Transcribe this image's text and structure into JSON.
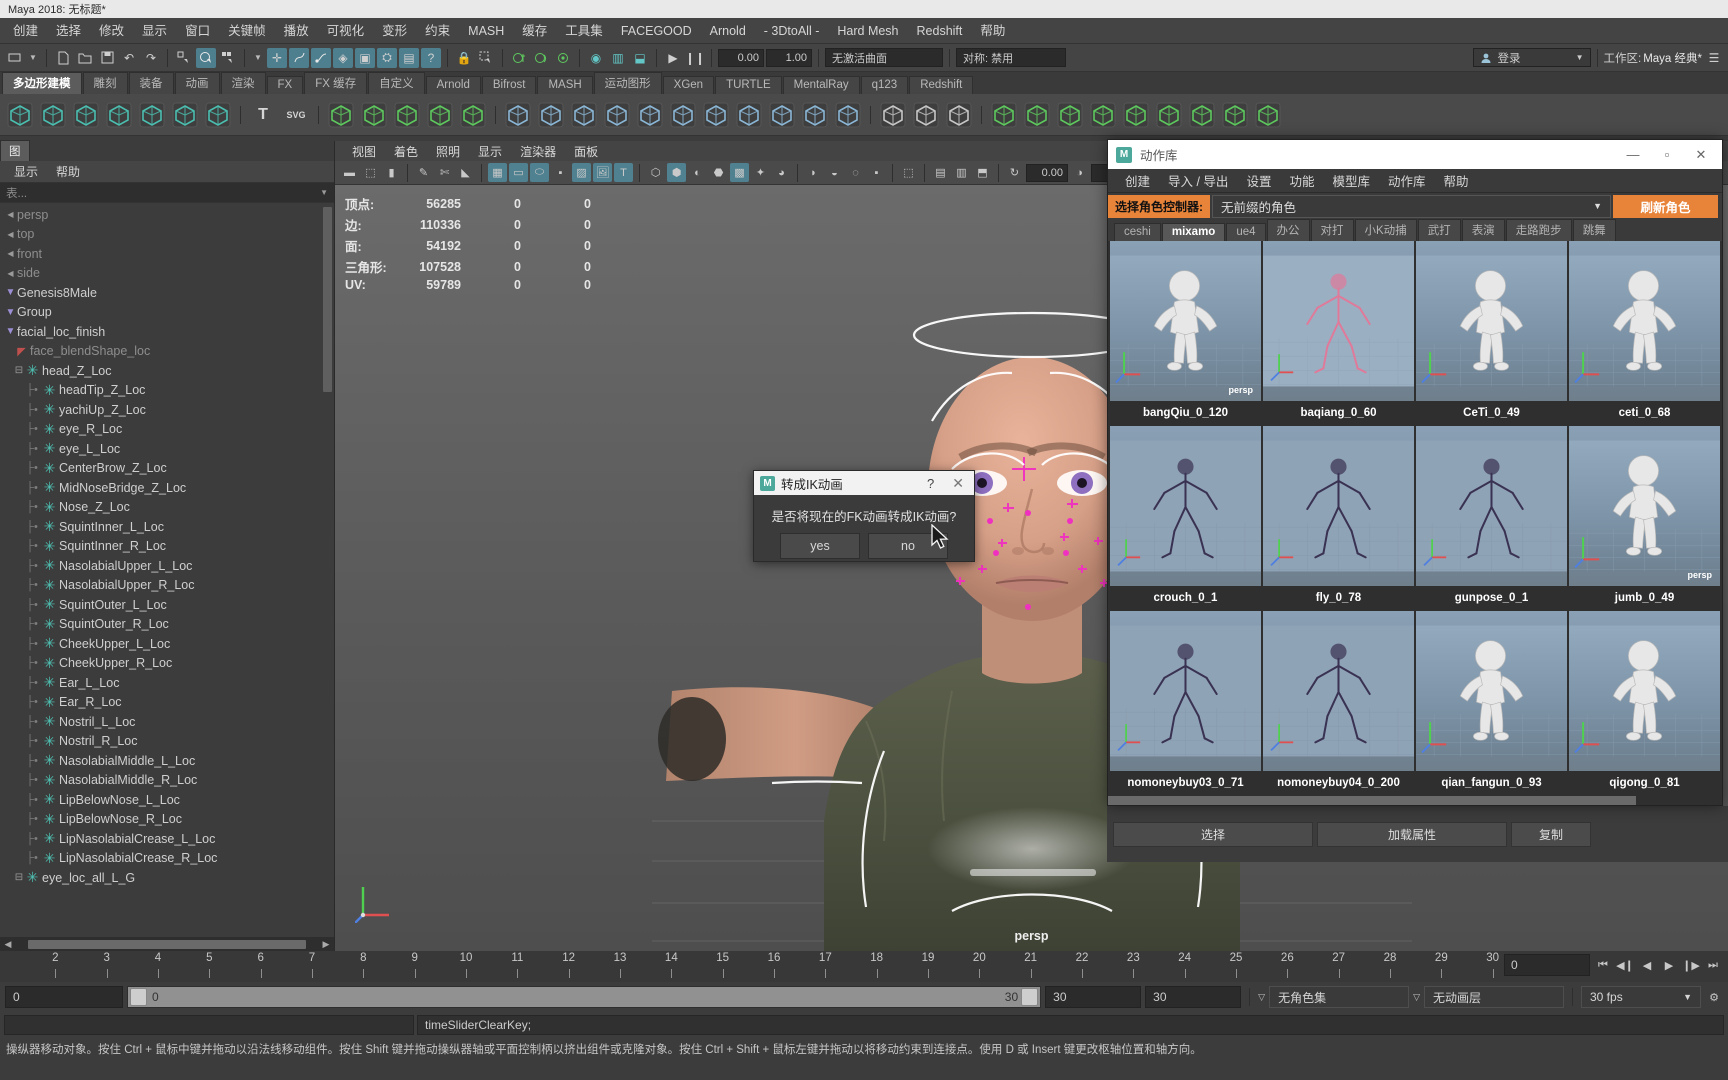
{
  "window": {
    "title": "Maya 2018: 无标题*"
  },
  "menubar": {
    "items": [
      "创建",
      "选择",
      "修改",
      "显示",
      "窗口",
      "关键帧",
      "播放",
      "可视化",
      "变形",
      "约束",
      "MASH",
      "缓存",
      "工具集",
      "FACEGOOD",
      "Arnold",
      "- 3DtoAll -",
      "Hard Mesh",
      "Redshift",
      "帮助"
    ]
  },
  "status_bar": {
    "symmetry_label": "对称: 禁用",
    "active_curve_field": "无激活曲面",
    "num_a": "0.00",
    "num_b": "1.00",
    "login_label": "登录",
    "workspace_label": "工作区:",
    "workspace_value": "Maya 经典*"
  },
  "shelf": {
    "tabs": [
      "多边形建模",
      "雕刻",
      "装备",
      "动画",
      "渲染",
      "FX",
      "FX 缓存",
      "自定义",
      "Arnold",
      "Bifrost",
      "MASH",
      "运动图形",
      "XGen",
      "TURTLE",
      "MentalRay",
      "q123",
      "Redshift"
    ],
    "active_tab": "多边形建模"
  },
  "outliner": {
    "tab_label": "图",
    "menu": [
      "显示",
      "帮助"
    ],
    "search_placeholder": "表...",
    "items": [
      {
        "label": "persp",
        "type": "camera",
        "dim": true,
        "indent": 0
      },
      {
        "label": "top",
        "type": "camera",
        "dim": true,
        "indent": 0
      },
      {
        "label": "front",
        "type": "camera",
        "dim": true,
        "indent": 0
      },
      {
        "label": "side",
        "type": "camera",
        "dim": true,
        "indent": 0
      },
      {
        "label": "Genesis8Male",
        "type": "group",
        "dim": false,
        "indent": 0
      },
      {
        "label": "Group",
        "type": "group",
        "dim": false,
        "indent": 0
      },
      {
        "label": "facial_loc_finish",
        "type": "group",
        "dim": false,
        "indent": 0
      },
      {
        "label": "face_blendShape_loc",
        "type": "blendshape",
        "dim": true,
        "indent": 1
      },
      {
        "label": "head_Z_Loc",
        "type": "locator-root",
        "dim": false,
        "indent": 1
      },
      {
        "label": "headTip_Z_Loc",
        "type": "locator",
        "dim": false,
        "indent": 2
      },
      {
        "label": "yachiUp_Z_Loc",
        "type": "locator",
        "dim": false,
        "indent": 2
      },
      {
        "label": "eye_R_Loc",
        "type": "locator",
        "dim": false,
        "indent": 2
      },
      {
        "label": "eye_L_Loc",
        "type": "locator",
        "dim": false,
        "indent": 2
      },
      {
        "label": "CenterBrow_Z_Loc",
        "type": "locator",
        "dim": false,
        "indent": 2
      },
      {
        "label": "MidNoseBridge_Z_Loc",
        "type": "locator",
        "dim": false,
        "indent": 2
      },
      {
        "label": "Nose_Z_Loc",
        "type": "locator",
        "dim": false,
        "indent": 2
      },
      {
        "label": "SquintInner_L_Loc",
        "type": "locator",
        "dim": false,
        "indent": 2
      },
      {
        "label": "SquintInner_R_Loc",
        "type": "locator",
        "dim": false,
        "indent": 2
      },
      {
        "label": "NasolabialUpper_L_Loc",
        "type": "locator",
        "dim": false,
        "indent": 2
      },
      {
        "label": "NasolabialUpper_R_Loc",
        "type": "locator",
        "dim": false,
        "indent": 2
      },
      {
        "label": "SquintOuter_L_Loc",
        "type": "locator",
        "dim": false,
        "indent": 2
      },
      {
        "label": "SquintOuter_R_Loc",
        "type": "locator",
        "dim": false,
        "indent": 2
      },
      {
        "label": "CheekUpper_L_Loc",
        "type": "locator",
        "dim": false,
        "indent": 2
      },
      {
        "label": "CheekUpper_R_Loc",
        "type": "locator",
        "dim": false,
        "indent": 2
      },
      {
        "label": "Ear_L_Loc",
        "type": "locator",
        "dim": false,
        "indent": 2
      },
      {
        "label": "Ear_R_Loc",
        "type": "locator",
        "dim": false,
        "indent": 2
      },
      {
        "label": "Nostril_L_Loc",
        "type": "locator",
        "dim": false,
        "indent": 2
      },
      {
        "label": "Nostril_R_Loc",
        "type": "locator",
        "dim": false,
        "indent": 2
      },
      {
        "label": "NasolabialMiddle_L_Loc",
        "type": "locator",
        "dim": false,
        "indent": 2
      },
      {
        "label": "NasolabialMiddle_R_Loc",
        "type": "locator",
        "dim": false,
        "indent": 2
      },
      {
        "label": "LipBelowNose_L_Loc",
        "type": "locator",
        "dim": false,
        "indent": 2
      },
      {
        "label": "LipBelowNose_R_Loc",
        "type": "locator",
        "dim": false,
        "indent": 2
      },
      {
        "label": "LipNasolabialCrease_L_Loc",
        "type": "locator",
        "dim": false,
        "indent": 2
      },
      {
        "label": "LipNasolabialCrease_R_Loc",
        "type": "locator",
        "dim": false,
        "indent": 2
      },
      {
        "label": "eye_loc_all_L_G",
        "type": "locator-root",
        "dim": false,
        "indent": 1
      }
    ]
  },
  "viewport": {
    "menu": [
      "视图",
      "着色",
      "照明",
      "显示",
      "渲染器",
      "面板"
    ],
    "hud": [
      {
        "label": "顶点:",
        "v1": "56285",
        "v2": "0",
        "v3": "0"
      },
      {
        "label": "边:",
        "v1": "110336",
        "v2": "0",
        "v3": "0"
      },
      {
        "label": "面:",
        "v1": "54192",
        "v2": "0",
        "v3": "0"
      },
      {
        "label": "三角形:",
        "v1": "107528",
        "v2": "0",
        "v3": "0"
      },
      {
        "label": "UV:",
        "v1": "59789",
        "v2": "0",
        "v3": "0"
      }
    ],
    "camera_label": "persp"
  },
  "dialog": {
    "title": "转成IK动画",
    "help_glyph": "?",
    "close_glyph": "✕",
    "message": "是否将现在的FK动画转成IK动画?",
    "yes_label": "yes",
    "no_label": "no"
  },
  "motion_library": {
    "title": "动作库",
    "minimize_glyph": "—",
    "maximize_glyph": "▫",
    "close_glyph": "✕",
    "menu": [
      "创建",
      "导入 / 导出",
      "设置",
      "功能",
      "模型库",
      "动作库",
      "帮助"
    ],
    "selector_label": "选择角色控制器:",
    "selector_value": "无前缀的角色",
    "refresh_label": "刷新角色",
    "tabs": [
      "ceshi",
      "mixamo",
      "ue4",
      "办公",
      "对打",
      "小K动捕",
      "武打",
      "表演",
      "走路跑步",
      "跳舞"
    ],
    "active_tab": "mixamo",
    "items": [
      {
        "label": "bangQiu_0_120",
        "style": "mannequin",
        "badge": "persp"
      },
      {
        "label": "baqiang_0_60",
        "style": "stick-red",
        "badge": ""
      },
      {
        "label": "CeTi_0_49",
        "style": "mannequin",
        "badge": ""
      },
      {
        "label": "ceti_0_68",
        "style": "mannequin",
        "badge": ""
      },
      {
        "label": "crouch_0_1",
        "style": "stick-dark",
        "badge": ""
      },
      {
        "label": "fly_0_78",
        "style": "stick-dark",
        "badge": ""
      },
      {
        "label": "gunpose_0_1",
        "style": "stick-dark",
        "badge": ""
      },
      {
        "label": "jumb_0_49",
        "style": "mannequin",
        "badge": "persp"
      },
      {
        "label": "nomoneybuy03_0_71",
        "style": "stick-dark",
        "badge": ""
      },
      {
        "label": "nomoneybuy04_0_200",
        "style": "stick-dark",
        "badge": ""
      },
      {
        "label": "qian_fangun_0_93",
        "style": "mannequin",
        "badge": ""
      },
      {
        "label": "qigong_0_81",
        "style": "mannequin",
        "badge": ""
      }
    ]
  },
  "attribute_panel": {
    "select_label": "选择",
    "load_attr_label": "加载属性",
    "extra_label": "复制"
  },
  "timeline": {
    "ticks": [
      "2",
      "3",
      "4",
      "5",
      "6",
      "7",
      "8",
      "9",
      "10",
      "11",
      "12",
      "13",
      "14",
      "15",
      "16",
      "17",
      "18",
      "19",
      "20",
      "21",
      "22",
      "23",
      "24",
      "25",
      "26",
      "27",
      "28",
      "29",
      "30"
    ],
    "current_frame_field": "0"
  },
  "range_slider": {
    "start_field": "0",
    "slider_left_value": "0",
    "slider_right_value": "30",
    "anim_start": "30",
    "anim_end": "30",
    "character_set": "无角色集",
    "anim_layer": "无动画层",
    "fps": "30 fps"
  },
  "command_line": {
    "output": "timeSliderClearKey;"
  },
  "help_line": {
    "text": "操纵器移动对象。按住 Ctrl + 鼠标中键并拖动以沿法线移动组件。按住 Shift 键并拖动操纵器轴或平面控制柄以挤出组件或克隆对象。按住 Ctrl + Shift + 鼠标左键并拖动以将移动约束到连接点。使用 D 或 Insert 键更改枢轴位置和轴方向。"
  },
  "colors": {
    "accent_orange": "#e8833a",
    "locator_teal": "#4fc3b5",
    "panel_bg": "#3c3c3c",
    "active_blue": "#4f8190"
  }
}
